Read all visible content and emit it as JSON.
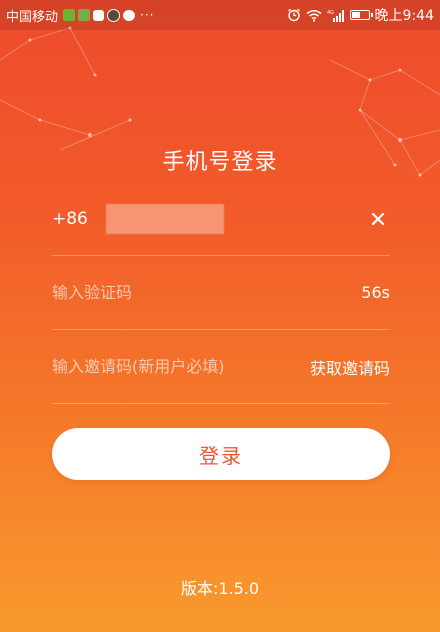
{
  "status_bar": {
    "carrier": "中国移动",
    "more": "···",
    "network": "4G",
    "time": "晚上9:44",
    "battery_level": 0.5
  },
  "login": {
    "title": "手机号登录",
    "country_code": "+86",
    "phone_value": "",
    "code_placeholder": "输入验证码",
    "countdown": "56s",
    "invite_placeholder": "输入邀请码(新用户必填)",
    "get_invite_label": "获取邀请码",
    "login_label": "登录"
  },
  "footer": {
    "version": "版本:1.5.0"
  },
  "icons": {
    "clear": "close-icon",
    "alarm": "alarm-icon",
    "wifi": "wifi-icon",
    "signal": "signal-icon",
    "battery": "battery-icon"
  },
  "colors": {
    "gradient_top": "#ee4a2c",
    "gradient_bottom": "#f89a2e",
    "button_text": "#f0552c"
  }
}
